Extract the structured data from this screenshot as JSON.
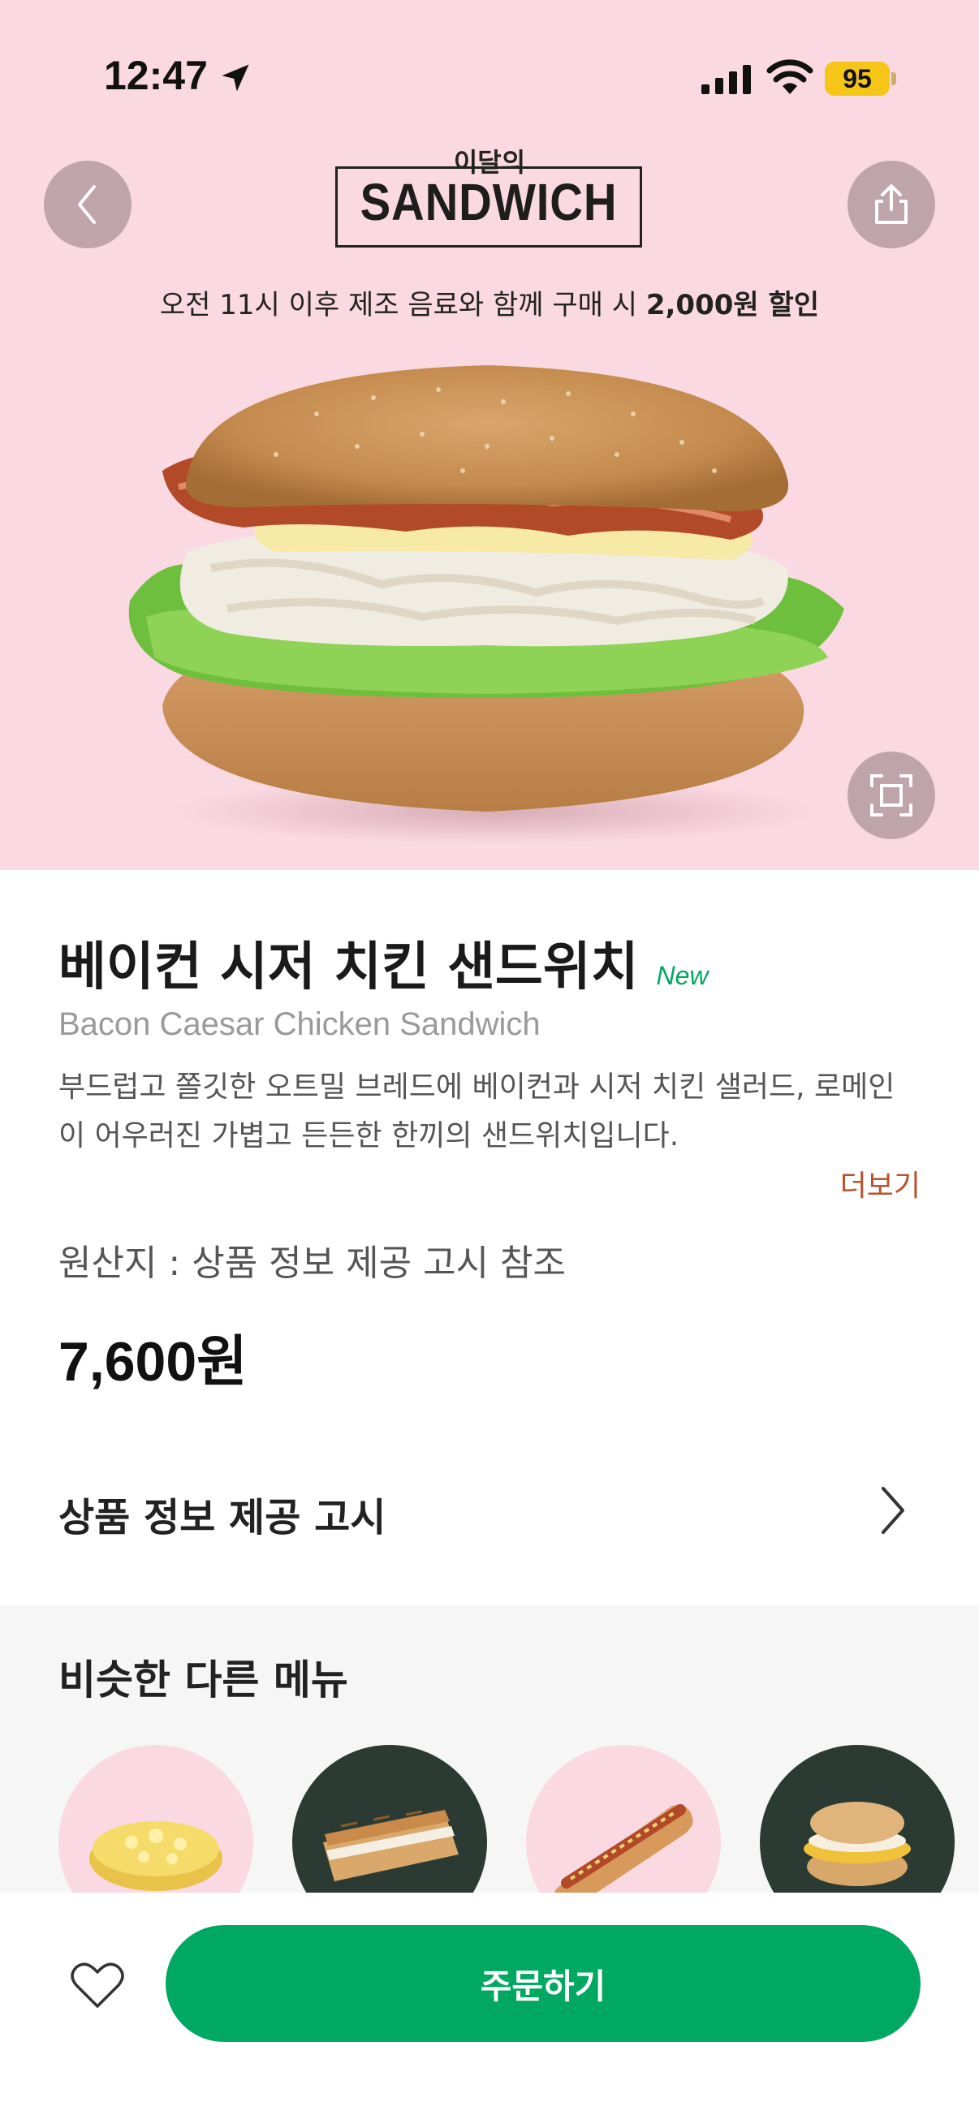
{
  "status_bar": {
    "time": "12:47",
    "battery": "95"
  },
  "hero": {
    "banner_top": "이달의",
    "banner_main": "SANDWICH",
    "promo_prefix": "오전 11시 이후 제조 음료와 함께 구매 시 ",
    "promo_highlight": "2,000원 할인",
    "background_color": "#fbd9e2"
  },
  "product": {
    "name_ko": "베이컨 시저 치킨 샌드위치",
    "badge": "New",
    "name_en": "Bacon Caesar Chicken Sandwich",
    "description": "부드럽고 쫄깃한 오트밀 브레드에 베이컨과 시저 치킨 샐러드, 로메인이 어우러진 가볍고 든든한 한끼의 샌드위치입니다.",
    "more_label": "더보기",
    "origin": "원산지 : 상품 정보 제공 고시 참조",
    "price": "7,600원"
  },
  "notice": {
    "label": "상품 정보 제공 고시"
  },
  "similar": {
    "title": "비슷한 다른 메뉴",
    "items": [
      {
        "name": "egg-sandwich",
        "bg": "#fbd9e2"
      },
      {
        "name": "panini",
        "bg": "#2b3a33"
      },
      {
        "name": "hot-dog",
        "bg": "#fbd9e2"
      },
      {
        "name": "english-muffin",
        "bg": "#2b3a33"
      }
    ]
  },
  "bottom_bar": {
    "order_label": "주문하기",
    "accent_color": "#00a862"
  }
}
